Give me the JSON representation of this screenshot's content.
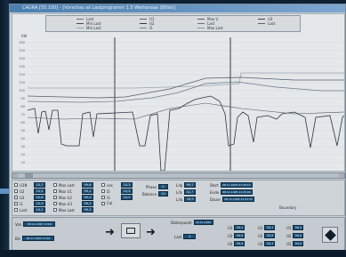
{
  "window": {
    "title": "CAGRA [55.100] - [Vorschau at Lastprogramm 1.5 Werkeraaa (Bitte)]"
  },
  "legend": {
    "items": [
      {
        "label": "Last",
        "color": "#6b737b"
      },
      {
        "label": "Min.Last",
        "color": "#454d55"
      },
      {
        "label": "Min Last",
        "color": "#9aa2aa"
      },
      {
        "label": "U1",
        "color": "#5a6470"
      },
      {
        "label": "U2",
        "color": "#333a42"
      },
      {
        "label": "I1",
        "color": "#7c8590"
      },
      {
        "label": "Max U",
        "color": "#525b65"
      },
      {
        "label": "Last",
        "color": "#6b737b"
      },
      {
        "label": "Max Last",
        "color": "#8d96a0"
      },
      {
        "label": "U3",
        "color": "#3c444d"
      },
      {
        "label": "Last",
        "color": "#5a6470"
      }
    ]
  },
  "chart": {
    "y_unit": "kW",
    "y_ticks": [
      "160",
      "150",
      "140",
      "130",
      "120",
      "110",
      "100",
      "90",
      "80",
      "70",
      "60",
      "50",
      "40",
      "30",
      "20",
      "10"
    ]
  },
  "controls": {
    "col1": [
      {
        "label": "U1N",
        "value": "10,7"
      },
      {
        "label": "U2",
        "value": "10,5"
      },
      {
        "label": "U3",
        "value": "10,6"
      },
      {
        "label": "I1",
        "value": "10,3"
      },
      {
        "label": "Last",
        "value": "10,1"
      }
    ],
    "col2": [
      {
        "label": "Max Last",
        "value": "99,6"
      },
      {
        "label": "Max U1",
        "value": "99,1"
      },
      {
        "label": "Max U2",
        "value": "99,0"
      },
      {
        "label": "Max U3",
        "value": "99,2"
      },
      {
        "label": "Max Last",
        "value": "99,3"
      }
    ],
    "col3": [
      {
        "label": "cos",
        "value": "10,3"
      },
      {
        "label": "I2",
        "value": "10,5"
      },
      {
        "label": "I3",
        "value": "10,2"
      },
      {
        "label": "Cal",
        "value": ""
      }
    ],
    "fields": [
      {
        "label": "Phase",
        "value": "0"
      },
      {
        "label": "Balance",
        "value": "10"
      },
      {
        "label": "L/Ip",
        "value": "99,7"
      },
      {
        "label": "L/Is",
        "value": "32,7"
      },
      {
        "label": "L/Ia",
        "value": "16,9"
      },
      {
        "label": "Start",
        "value": "08.11.1995 07:28:15"
      },
      {
        "label": "Ende",
        "value": "08.11.1995 11:25:00"
      },
      {
        "label": "Dauer",
        "value": "08.11.1995 11:51:35"
      }
    ],
    "status": "Boundary"
  },
  "bottom": {
    "from_label": "Von",
    "from_value": "08.11.1995 13:09",
    "to_label": "Bis",
    "to_value": "08.11.1995 13:40",
    "list_label": "Datenpunkt",
    "list_value": "16.11.1995",
    "sub_label": "Last",
    "sub_value": "4",
    "grid": [
      [
        "U1",
        "34,1",
        "U1",
        "34,1",
        "U1",
        "34,3"
      ],
      [
        "U2",
        "34,0",
        "U2",
        "33,9",
        "U2",
        "34,5"
      ],
      [
        "U3",
        "34,3",
        "U3",
        "34,1",
        "U3",
        "34,0"
      ]
    ]
  }
}
